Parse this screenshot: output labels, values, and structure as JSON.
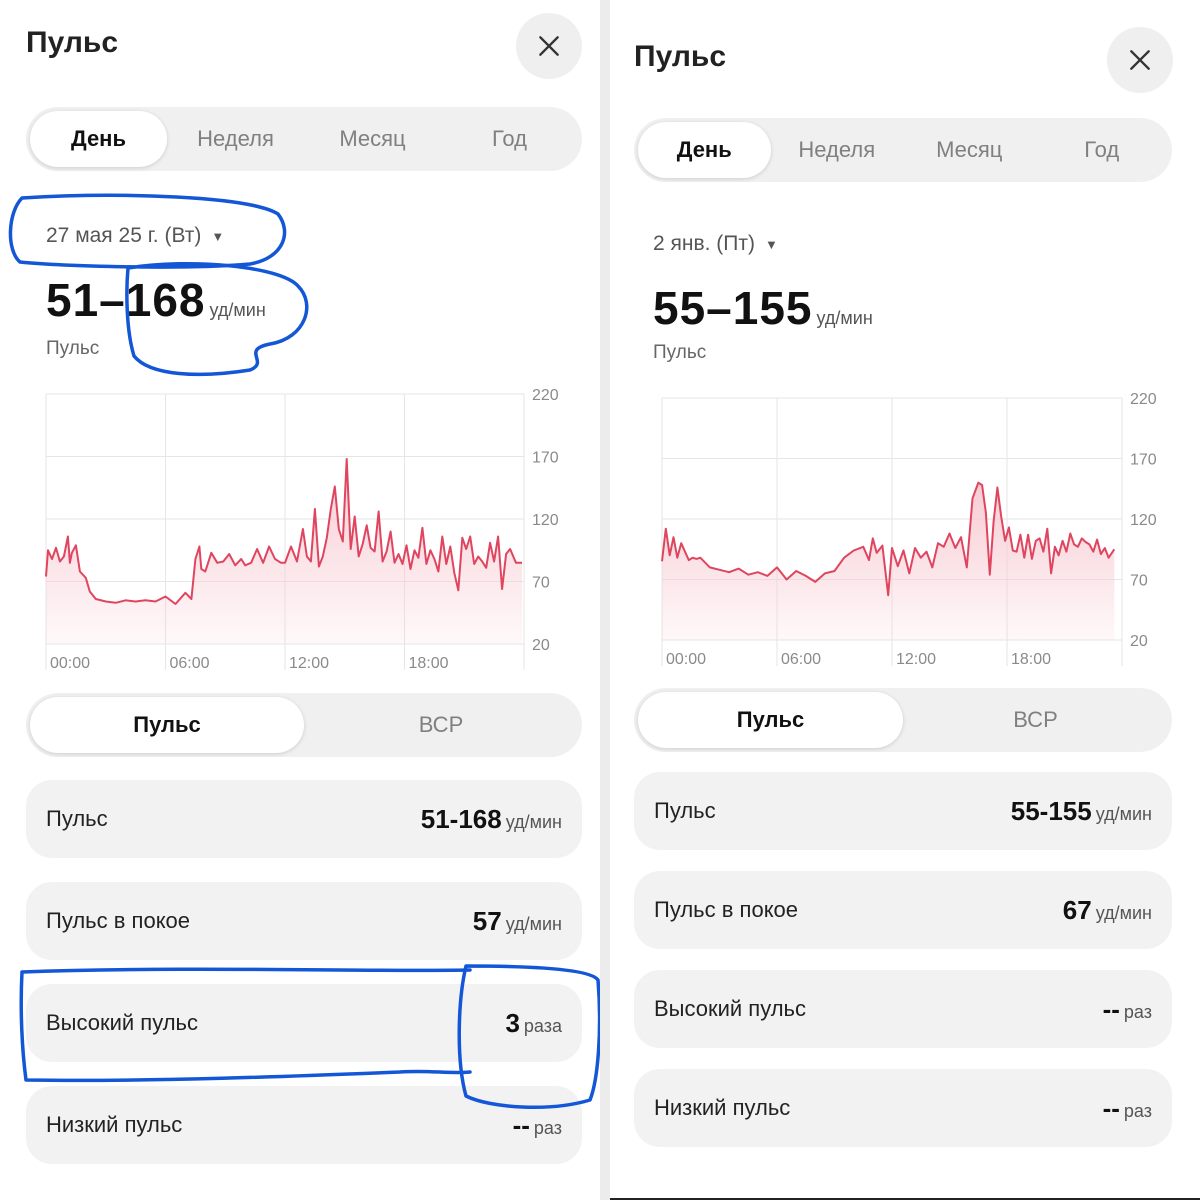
{
  "left": {
    "title": "Пульс",
    "tabs": [
      "День",
      "Неделя",
      "Месяц",
      "Год"
    ],
    "active_tab": 0,
    "date": "27 мая 25 г. (Вт)",
    "range_value": "51–168",
    "range_unit": "уд/мин",
    "range_label": "Пульс",
    "mode_tabs": [
      "Пульс",
      "ВСР"
    ],
    "cards": [
      {
        "label": "Пульс",
        "value": "51-168",
        "unit": "уд/мин"
      },
      {
        "label": "Пульс в покое",
        "value": "57",
        "unit": "уд/мин"
      },
      {
        "label": "Высокий пульс",
        "value": "3",
        "unit": "раза"
      },
      {
        "label": "Низкий пульс",
        "value": "--",
        "unit": "раз"
      }
    ]
  },
  "right": {
    "title": "Пульс",
    "tabs": [
      "День",
      "Неделя",
      "Месяц",
      "Год"
    ],
    "active_tab": 0,
    "date": "2 янв. (Пт)",
    "range_value": "55–155",
    "range_unit": "уд/мин",
    "range_label": "Пульс",
    "mode_tabs": [
      "Пульс",
      "ВСР"
    ],
    "cards": [
      {
        "label": "Пульс",
        "value": "55-155",
        "unit": "уд/мин"
      },
      {
        "label": "Пульс в покое",
        "value": "67",
        "unit": "уд/мин"
      },
      {
        "label": "Высокий пульс",
        "value": "--",
        "unit": "раз"
      },
      {
        "label": "Низкий пульс",
        "value": "--",
        "unit": "раз"
      }
    ]
  },
  "colors": {
    "line": "#e0455f",
    "fill": "#f7c9d1",
    "annotation": "#1457d6",
    "card_bg": "#f2f2f2"
  },
  "icons": {
    "close": "close-icon",
    "date_caret": "caret-down-icon"
  },
  "chart_data": [
    {
      "type": "area",
      "x_ticks": [
        "00:00",
        "06:00",
        "12:00",
        "18:00"
      ],
      "y_ticks": [
        220,
        170,
        120,
        70,
        20
      ],
      "ylim": [
        20,
        220
      ],
      "xlim": [
        0,
        24
      ],
      "series": [
        {
          "x": [
            0,
            0.1,
            0.3,
            0.5,
            0.7,
            0.9,
            1.1,
            1.2,
            1.3,
            1.5,
            1.7,
            2.0,
            2.2,
            2.5,
            3.0,
            3.5,
            4.0,
            4.5,
            5.0,
            5.5,
            6.0,
            6.5,
            7.0,
            7.3,
            7.5,
            7.7,
            7.8,
            8.0,
            8.3,
            8.6,
            8.9,
            9.2,
            9.5,
            9.8,
            10.0,
            10.3,
            10.6,
            10.9,
            11.2,
            11.5,
            11.8,
            12.0,
            12.3,
            12.6,
            12.9,
            13.1,
            13.3,
            13.5,
            13.7,
            13.9,
            14.1,
            14.3,
            14.5,
            14.7,
            14.9,
            15.1,
            15.3,
            15.5,
            15.7,
            15.9,
            16.1,
            16.3,
            16.5,
            16.7,
            16.9,
            17.1,
            17.3,
            17.5,
            17.7,
            17.9,
            18.1,
            18.3,
            18.5,
            18.7,
            18.9,
            19.1,
            19.3,
            19.5,
            19.7,
            19.9,
            20.1,
            20.3,
            20.5,
            20.7,
            20.9,
            21.1,
            21.3,
            21.5,
            21.7,
            21.9,
            22.1,
            22.3,
            22.5,
            22.7,
            22.9,
            23.1,
            23.3,
            23.6,
            23.9
          ],
          "y": [
            74,
            95,
            88,
            97,
            86,
            90,
            106,
            85,
            93,
            99,
            78,
            73,
            62,
            56,
            54,
            53,
            55,
            54,
            55,
            54,
            58,
            52,
            61,
            56,
            88,
            98,
            80,
            78,
            93,
            85,
            86,
            92,
            83,
            88,
            83,
            85,
            96,
            85,
            98,
            88,
            85,
            85,
            98,
            86,
            112,
            90,
            86,
            128,
            82,
            90,
            105,
            128,
            146,
            112,
            102,
            168,
            96,
            122,
            90,
            100,
            115,
            97,
            94,
            126,
            86,
            94,
            110,
            85,
            92,
            84,
            99,
            80,
            95,
            89,
            113,
            84,
            95,
            88,
            78,
            106,
            84,
            98,
            77,
            63,
            105,
            96,
            106,
            84,
            90,
            86,
            81,
            101,
            86,
            106,
            64,
            92,
            96,
            85,
            85
          ]
        }
      ]
    },
    {
      "type": "area",
      "x_ticks": [
        "00:00",
        "06:00",
        "12:00",
        "18:00"
      ],
      "y_ticks": [
        220,
        170,
        120,
        70,
        20
      ],
      "ylim": [
        20,
        220
      ],
      "xlim": [
        0,
        24
      ],
      "series": [
        {
          "x": [
            0,
            0.2,
            0.4,
            0.6,
            0.8,
            1.0,
            1.2,
            1.4,
            1.6,
            1.8,
            2.0,
            2.5,
            3.0,
            3.5,
            4.0,
            4.5,
            5.0,
            5.5,
            6.0,
            6.5,
            7.0,
            7.5,
            8.0,
            8.5,
            9.0,
            9.5,
            10.0,
            10.5,
            10.8,
            11.0,
            11.2,
            11.5,
            11.8,
            12.0,
            12.3,
            12.6,
            12.9,
            13.2,
            13.5,
            13.8,
            14.1,
            14.4,
            14.7,
            15.0,
            15.3,
            15.6,
            15.9,
            16.2,
            16.5,
            16.7,
            16.9,
            17.1,
            17.3,
            17.5,
            17.7,
            17.9,
            18.1,
            18.3,
            18.5,
            18.7,
            18.9,
            19.1,
            19.3,
            19.5,
            19.7,
            19.9,
            20.1,
            20.3,
            20.5,
            20.7,
            20.9,
            21.1,
            21.3,
            21.5,
            21.7,
            21.9,
            22.1,
            22.3,
            22.5,
            22.7,
            22.9,
            23.1,
            23.3,
            23.6
          ],
          "y": [
            85,
            112,
            90,
            105,
            88,
            100,
            93,
            86,
            88,
            87,
            88,
            80,
            78,
            76,
            79,
            74,
            76,
            73,
            80,
            70,
            77,
            73,
            68,
            75,
            77,
            88,
            94,
            97,
            86,
            104,
            92,
            98,
            57,
            96,
            81,
            94,
            75,
            96,
            88,
            93,
            80,
            100,
            97,
            108,
            96,
            105,
            80,
            137,
            150,
            148,
            125,
            74,
            118,
            146,
            122,
            102,
            113,
            94,
            93,
            107,
            88,
            107,
            87,
            102,
            104,
            93,
            112,
            75,
            97,
            90,
            102,
            93,
            108,
            99,
            97,
            104,
            101,
            99,
            93,
            103,
            91,
            96,
            88,
            95
          ]
        }
      ]
    }
  ]
}
